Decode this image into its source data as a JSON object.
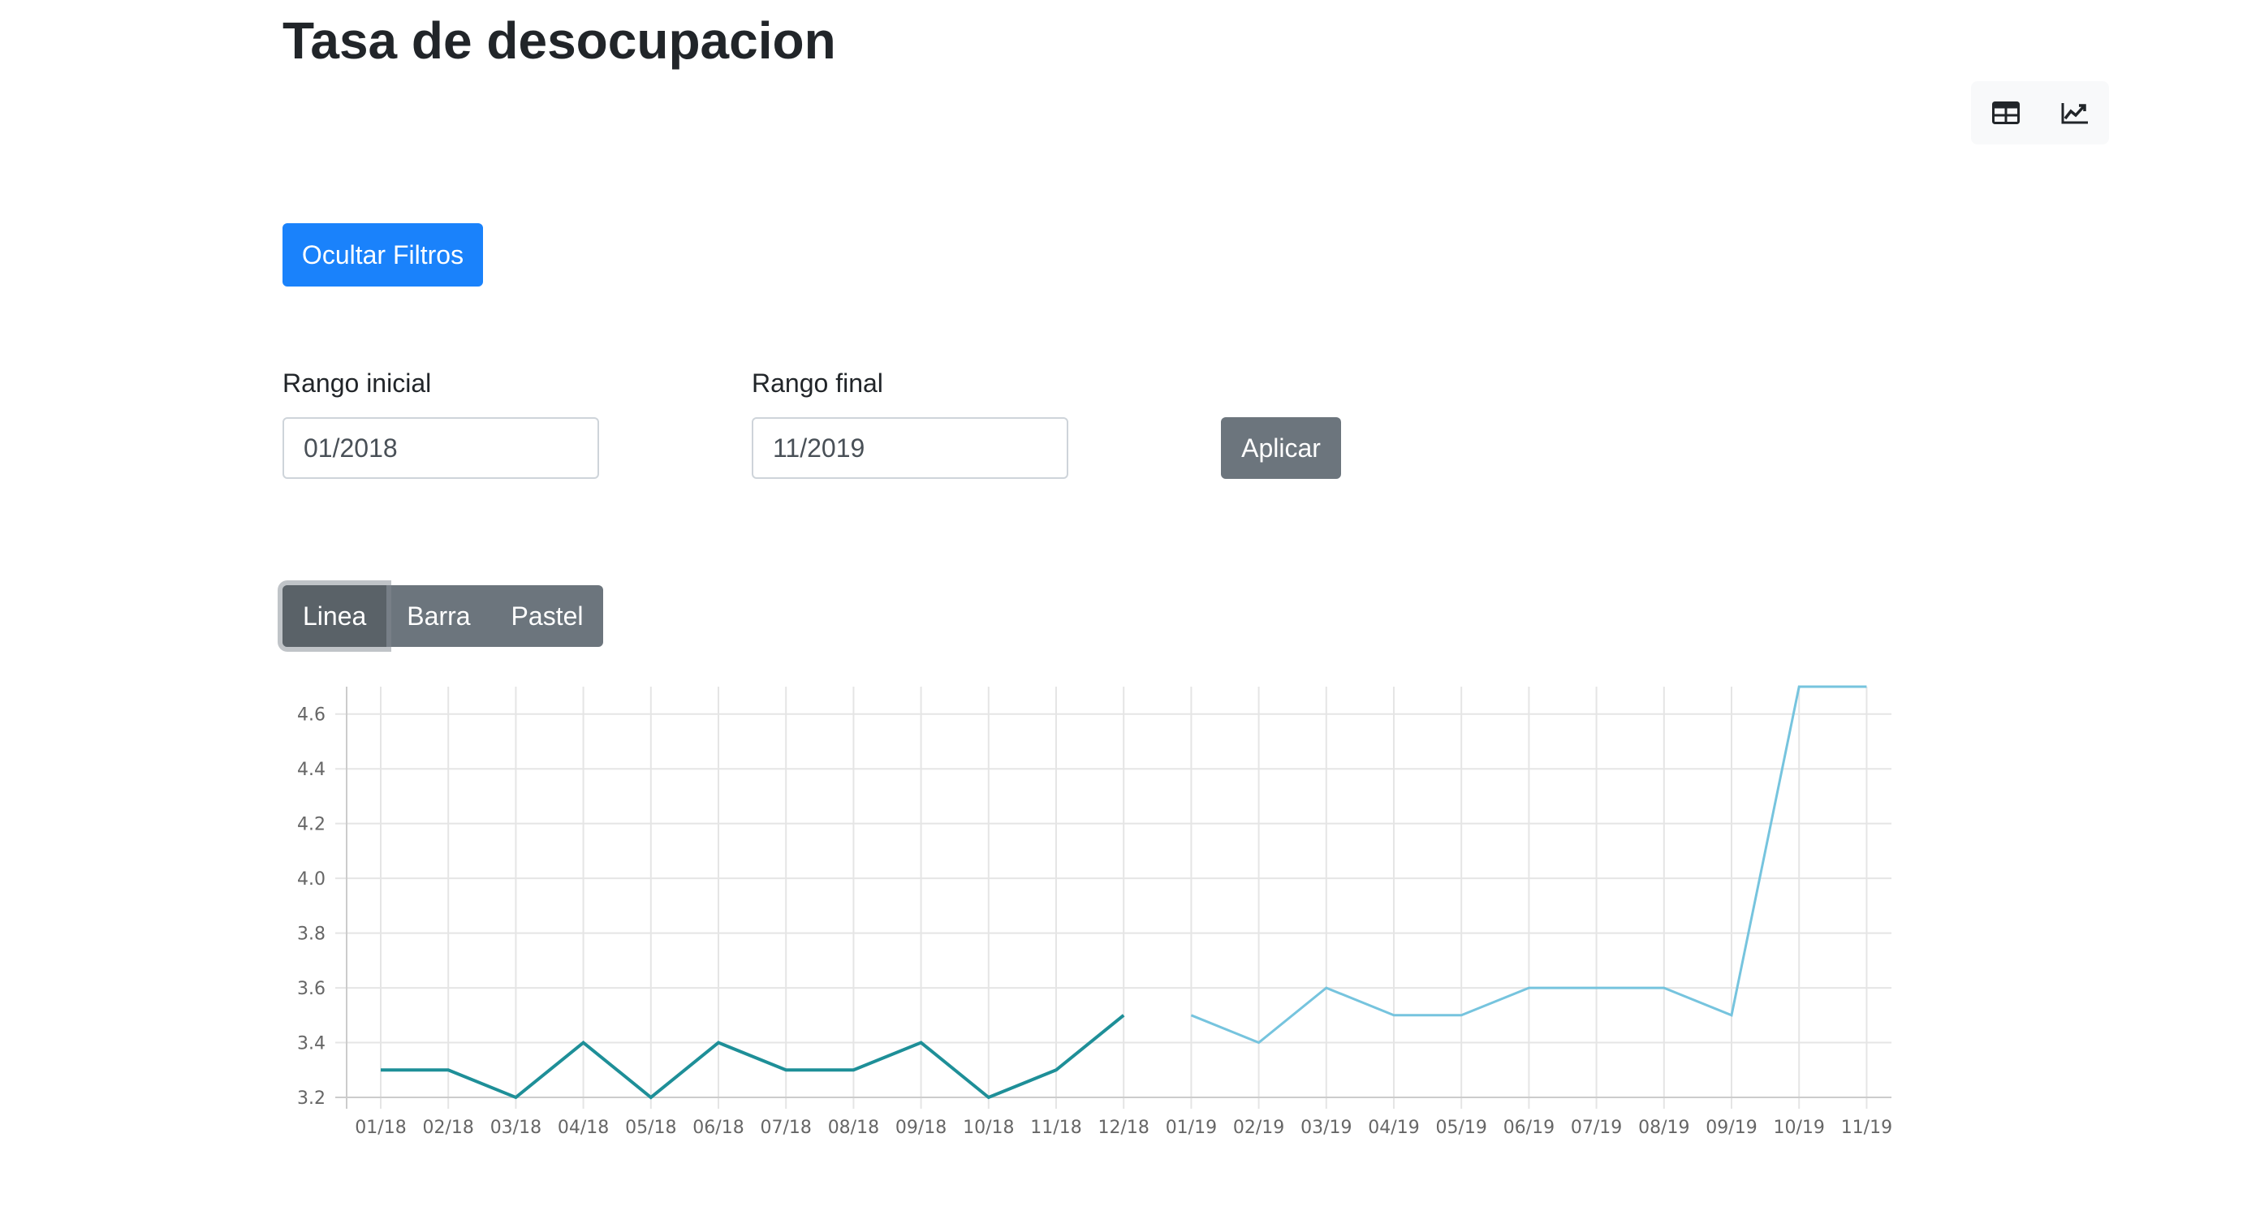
{
  "header": {
    "title": "Tasa de desocupacion"
  },
  "view_toggle": {
    "table_icon": "table-icon",
    "chart_icon": "line-chart-icon"
  },
  "filters": {
    "toggle_label": "Ocultar Filtros",
    "start_label": "Rango inicial",
    "start_value": "01/2018",
    "end_label": "Rango final",
    "end_value": "11/2019",
    "apply_label": "Aplicar"
  },
  "chart_types": {
    "line": "Linea",
    "bar": "Barra",
    "pie": "Pastel",
    "active": "Linea"
  },
  "colors": {
    "primary": "#1a82fb",
    "secondary": "#6c757d",
    "series_2018": "#1e8f98",
    "series_2019": "#76c4de"
  },
  "chart_data": {
    "type": "line",
    "categories": [
      "01/18",
      "02/18",
      "03/18",
      "04/18",
      "05/18",
      "06/18",
      "07/18",
      "08/18",
      "09/18",
      "10/18",
      "11/18",
      "12/18",
      "01/19",
      "02/19",
      "03/19",
      "04/19",
      "05/19",
      "06/19",
      "07/19",
      "08/19",
      "09/19",
      "10/19",
      "11/19"
    ],
    "series": [
      {
        "values": [
          3.3,
          3.3,
          3.2,
          3.4,
          3.2,
          3.4,
          3.3,
          3.3,
          3.4,
          3.2,
          3.3,
          3.5,
          null,
          null,
          null,
          null,
          null,
          null,
          null,
          null,
          null,
          null,
          null
        ],
        "color": "#1e8f98"
      },
      {
        "values": [
          null,
          null,
          null,
          null,
          null,
          null,
          null,
          null,
          null,
          null,
          null,
          null,
          3.5,
          3.4,
          3.6,
          3.5,
          3.5,
          3.6,
          3.6,
          3.6,
          3.5,
          4.7,
          4.7
        ],
        "color": "#76c4de"
      }
    ],
    "yticks": [
      3.2,
      3.4,
      3.6,
      3.8,
      4.0,
      4.2,
      4.4,
      4.6
    ],
    "ylim": [
      3.2,
      4.7
    ],
    "grid": true,
    "legend": "none",
    "xlabel": "",
    "ylabel": ""
  }
}
